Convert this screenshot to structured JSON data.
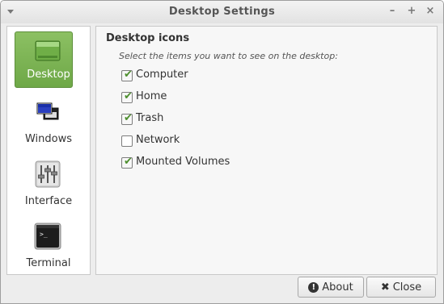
{
  "window": {
    "title": "Desktop Settings",
    "minimize_glyph": "–",
    "maximize_glyph": "+",
    "close_glyph": "×"
  },
  "sidebar": {
    "items": [
      {
        "label": "Desktop",
        "icon": "desktop-icon",
        "active": true
      },
      {
        "label": "Windows",
        "icon": "windows-icon",
        "active": false
      },
      {
        "label": "Interface",
        "icon": "interface-sliders-icon",
        "active": false
      },
      {
        "label": "Terminal",
        "icon": "terminal-icon",
        "active": false
      }
    ]
  },
  "panel": {
    "section_title": "Desktop icons",
    "hint": "Select the items you want to see on the desktop:",
    "options": [
      {
        "label": "Computer",
        "checked": true
      },
      {
        "label": "Home",
        "checked": true
      },
      {
        "label": "Trash",
        "checked": true
      },
      {
        "label": "Network",
        "checked": false
      },
      {
        "label": "Mounted Volumes",
        "checked": true
      }
    ]
  },
  "buttons": {
    "about": {
      "label": "About",
      "icon": "info-icon"
    },
    "close": {
      "label": "Close",
      "icon": "close-x-icon"
    }
  },
  "colors": {
    "accent": "#7cb652",
    "check": "#4d8f2e"
  }
}
